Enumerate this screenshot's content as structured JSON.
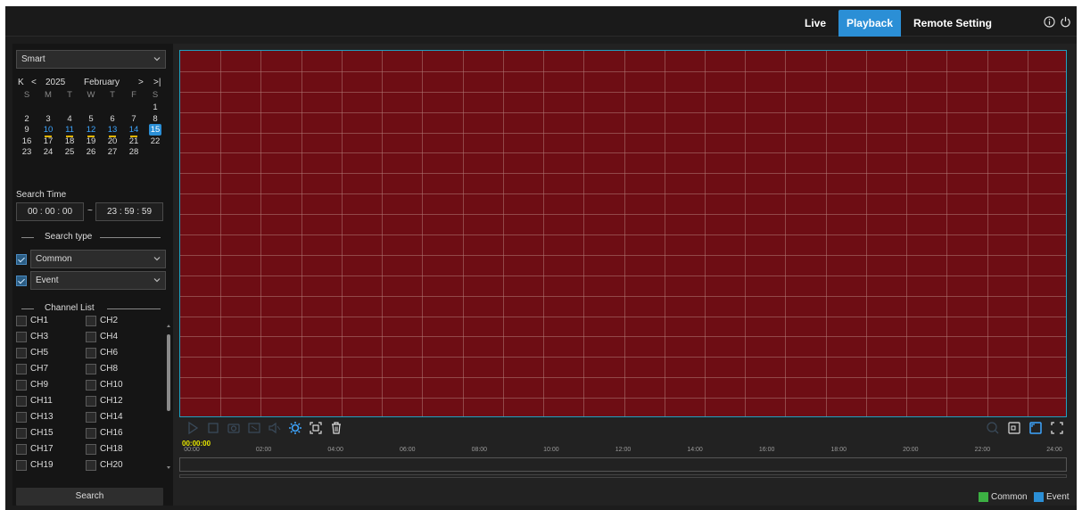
{
  "nav": {
    "live": "Live",
    "playback": "Playback",
    "remote": "Remote Setting"
  },
  "sidebar": {
    "mode": "Smart",
    "calendar": {
      "year": "2025",
      "month": "February",
      "weekdays": [
        "S",
        "M",
        "T",
        "W",
        "T",
        "F",
        "S"
      ],
      "first_weekday_index": 6,
      "days_in_month": 28,
      "record_days": [
        10,
        11,
        12,
        13,
        14
      ],
      "selected_day": 15
    },
    "search_time_label": "Search Time",
    "start_time": {
      "h": "00",
      "m": "00",
      "s": "00"
    },
    "end_time": {
      "h": "23",
      "m": "59",
      "s": "59"
    },
    "time_separator": "~",
    "search_type_label": "Search type",
    "search_types": [
      {
        "label": "Common",
        "checked": true
      },
      {
        "label": "Event",
        "checked": true
      }
    ],
    "channel_list_label": "Channel List",
    "channels": [
      "CH1",
      "CH2",
      "CH3",
      "CH4",
      "CH5",
      "CH6",
      "CH7",
      "CH8",
      "CH9",
      "CH10",
      "CH11",
      "CH12",
      "CH13",
      "CH14",
      "CH15",
      "CH16",
      "CH17",
      "CH18",
      "CH19",
      "CH20"
    ],
    "search_button": "Search"
  },
  "player": {
    "background_color": "#6e0d14",
    "grid_color": "#b07a74"
  },
  "timeline": {
    "current_time": "00:00:00",
    "ticks": [
      "00:00",
      "02:00",
      "04:00",
      "06:00",
      "08:00",
      "10:00",
      "12:00",
      "14:00",
      "16:00",
      "18:00",
      "20:00",
      "22:00",
      "24:00"
    ]
  },
  "legend": [
    {
      "label": "Common",
      "color": "#3cb043"
    },
    {
      "label": "Event",
      "color": "#2b8fd6"
    }
  ]
}
